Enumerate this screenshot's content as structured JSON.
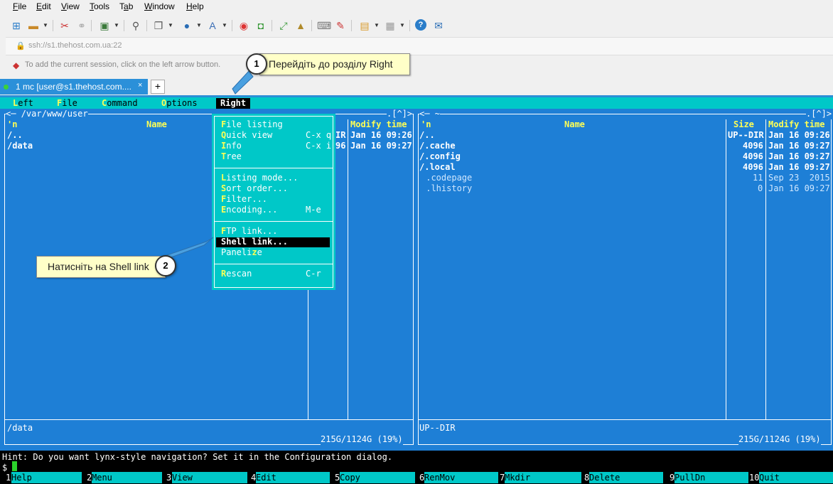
{
  "menu": [
    "File",
    "Edit",
    "View",
    "Tools",
    "Tab",
    "Window",
    "Help"
  ],
  "address": "ssh://s1.thehost.com.ua:22",
  "session_hint": "To add the current session, click on the left arrow button.",
  "tab": {
    "label": "1 mc [user@s1.thehost.com....",
    "close": "×",
    "new": "+"
  },
  "term_menu": [
    {
      "hot": "L",
      "rest": "eft"
    },
    {
      "hot": "F",
      "rest": "ile"
    },
    {
      "hot": "C",
      "rest": "ommand"
    },
    {
      "hot": "O",
      "rest": "ptions"
    },
    {
      "label": "Right"
    }
  ],
  "left_panel": {
    "path": "<─ /var/www/user",
    "right_marker": ".[^]>",
    "col_n": "'n",
    "col_name": "Name",
    "col_modify": "Modify time",
    "rows": [
      {
        "name": "/..",
        "size": "IR",
        "time": "Jan 16 09:26"
      },
      {
        "name": "/data",
        "size": "96",
        "time": "Jan 16 09:27"
      }
    ],
    "status": "/data",
    "disk": "215G/1124G (19%)"
  },
  "right_panel": {
    "path": "<─ ~",
    "right_marker": ".[^]>",
    "col_n": "'n",
    "col_name": "Name",
    "col_size": "Size",
    "col_modify": "Modify time",
    "rows": [
      {
        "name": "/..",
        "size": "UP--DIR",
        "time": "Jan 16 09:26",
        "bold": true
      },
      {
        "name": "/.cache",
        "size": "4096",
        "time": "Jan 16 09:27",
        "bold": true
      },
      {
        "name": "/.config",
        "size": "4096",
        "time": "Jan 16 09:27",
        "bold": true
      },
      {
        "name": "/.local",
        "size": "4096",
        "time": "Jan 16 09:27",
        "bold": true
      },
      {
        "name": " .codepage",
        "size": "11",
        "time": "Sep 23  2015",
        "bold": false
      },
      {
        "name": " .lhistory",
        "size": "0",
        "time": "Jan 16 09:27",
        "bold": false
      }
    ],
    "status": "UP--DIR",
    "disk": "215G/1124G (19%)"
  },
  "dropdown": [
    {
      "hot": "F",
      "rest": "ile listing",
      "sc": ""
    },
    {
      "hot": "Q",
      "rest": "uick view",
      "sc": "C-x q"
    },
    {
      "hot": "I",
      "rest": "nfo",
      "sc": "C-x i"
    },
    {
      "hot": "T",
      "rest": "ree",
      "sc": ""
    },
    {
      "hot": "L",
      "rest": "isting mode...",
      "sc": ""
    },
    {
      "hot": "S",
      "rest": "ort order...",
      "sc": ""
    },
    {
      "hot": "F",
      "rest": "ilter...",
      "sc": ""
    },
    {
      "hot": "E",
      "rest": "ncoding...",
      "sc": "M-e"
    },
    {
      "hot": "F",
      "rest": "TP link...",
      "sc": ""
    },
    {
      "hot": "",
      "rest": "Shell link...",
      "sc": ""
    },
    {
      "hot": "",
      "rest": "Paneli",
      "hot2": "z",
      "rest2": "e",
      "sc": ""
    },
    {
      "hot": "R",
      "rest": "escan",
      "sc": "C-r"
    }
  ],
  "hint_line": "Hint: Do you want lynx-style navigation? Set it in the Configuration dialog.",
  "prompt": "$",
  "fkeys": [
    {
      "n": "1",
      "l": "Help"
    },
    {
      "n": "2",
      "l": "Menu"
    },
    {
      "n": "3",
      "l": "View"
    },
    {
      "n": "4",
      "l": "Edit"
    },
    {
      "n": "5",
      "l": "Copy"
    },
    {
      "n": "6",
      "l": "RenMov"
    },
    {
      "n": "7",
      "l": "Mkdir"
    },
    {
      "n": "8",
      "l": "Delete"
    },
    {
      "n": "9",
      "l": "PullDn"
    },
    {
      "n": "10",
      "l": "Quit"
    }
  ],
  "callouts": [
    {
      "num": "1",
      "text": "Перейдіть до розділу Right"
    },
    {
      "num": "2",
      "text": "Натисніть на Shell link"
    }
  ]
}
